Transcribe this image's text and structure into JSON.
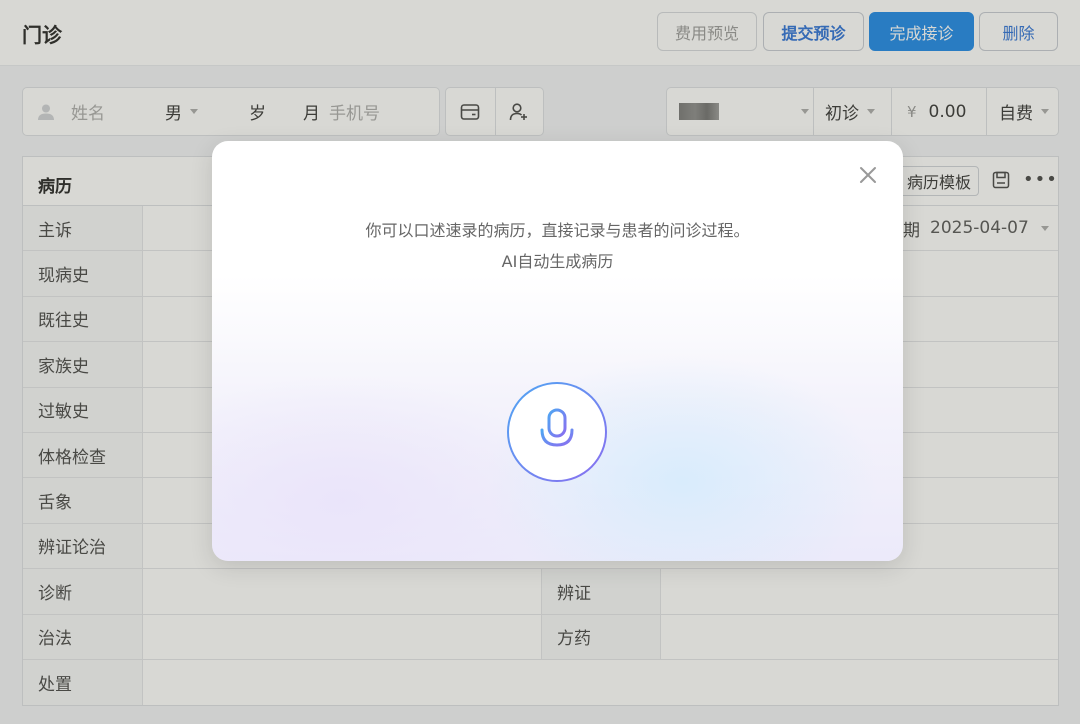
{
  "header": {
    "title": "门诊",
    "buttons": {
      "preview": "费用预览",
      "submit": "提交预诊",
      "done": "完成接诊",
      "delete": "删除"
    }
  },
  "patient": {
    "name_placeholder": "姓名",
    "gender": "男",
    "age_unit_year": "岁",
    "age_unit_month": "月",
    "phone_placeholder": "手机号",
    "tools": [
      "card-icon",
      "add-person-icon"
    ]
  },
  "visit": {
    "visit_type": "初诊",
    "currency": "¥",
    "fee": "0.00",
    "payment": "自费"
  },
  "record": {
    "title": "病历",
    "template_button": "病历模板",
    "date_label": "期",
    "date_value": "2025-04-07",
    "fields": [
      "主诉",
      "现病史",
      "既往史",
      "家族史",
      "过敏史",
      "体格检查",
      "舌象",
      "辨证论治",
      "诊断",
      "治法",
      "处置"
    ],
    "right_fields": {
      "diagnosis_row": "辨证",
      "treatment_row": "方药"
    }
  },
  "modal": {
    "line1": "你可以口述速录的病历，直接记录与患者的问诊过程。",
    "line2": "AI自动生成病历"
  },
  "colors": {
    "primary": "#1a86e8",
    "link_blue": "#2a6fd6",
    "mic_gradient_start": "#4fa6f2",
    "mic_gradient_end": "#8a6ef0"
  }
}
